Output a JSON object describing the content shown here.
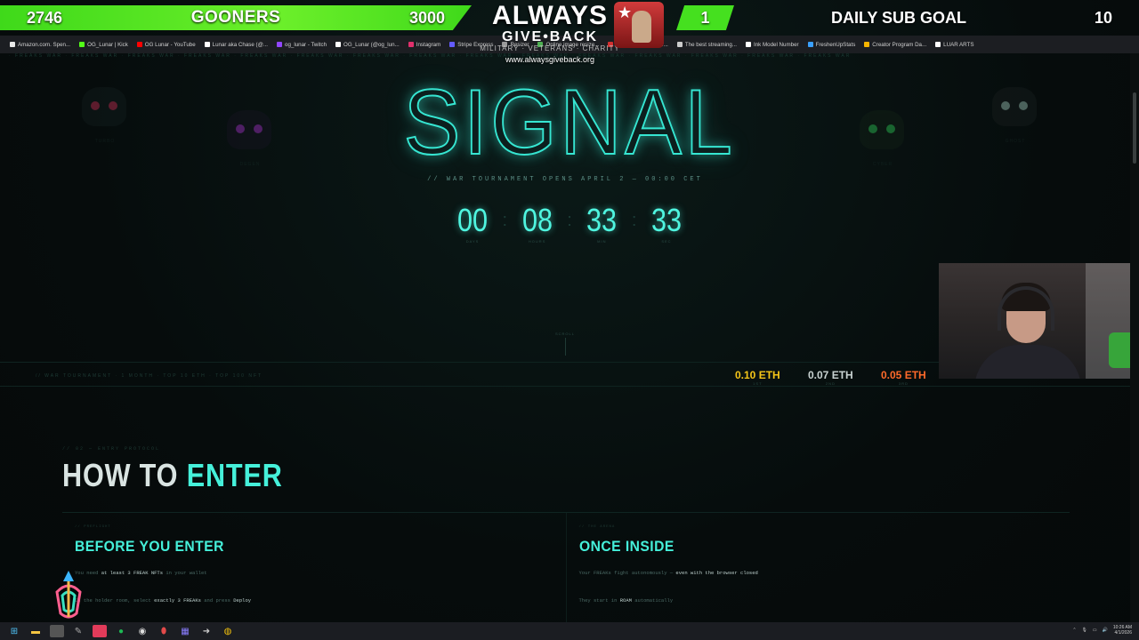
{
  "overlay": {
    "left_goal_current": "2746",
    "left_goal_name": "GOONERS",
    "left_goal_target": "3000",
    "right_goal_current": "1",
    "right_goal_name": "DAILY SUB GOAL",
    "right_goal_target": "10",
    "brand_line1": "ALWAYS",
    "brand_line2": "GIVE•BACK",
    "brand_tagline": "MILITARY · VETERANS · CHARITY",
    "brand_url": "www.alwaysgiveback.org"
  },
  "bookmarks": [
    {
      "label": "Amazon.com. Spen...",
      "color": "#e8e8e8"
    },
    {
      "label": "OG_Lunar | Kick",
      "color": "#53fc18"
    },
    {
      "label": "OG Lunar - YouTube",
      "color": "#ff0000"
    },
    {
      "label": "Lunar aka Chase (@...",
      "color": "#ffffff"
    },
    {
      "label": "og_lunar - Twitch",
      "color": "#9146ff"
    },
    {
      "label": "OG_Lunar (@og_lun...",
      "color": "#ffffff"
    },
    {
      "label": "Instagram",
      "color": "#e1306c"
    },
    {
      "label": "Stripe Express",
      "color": "#635bff"
    },
    {
      "label": "Resizer",
      "color": "#9a9a9a"
    },
    {
      "label": "Online image resize...",
      "color": "#4caf50"
    },
    {
      "label": "Myinstants | The lar...",
      "color": "#d32f2f"
    },
    {
      "label": "The best streaming...",
      "color": "#cccccc"
    },
    {
      "label": "Ink Model Number",
      "color": "#ffffff"
    },
    {
      "label": "FreshenUpStats",
      "color": "#3aa0ff"
    },
    {
      "label": "Creator Program Da...",
      "color": "#f5b400"
    },
    {
      "label": "LUAR ARTS",
      "color": "#ffffff"
    }
  ],
  "hero": {
    "title": "SIGNAL",
    "subtitle": "// WAR TOURNAMENT OPENS APRIL 2 — 00:00 CET",
    "countdown": [
      {
        "value": "00",
        "label": "DAYS"
      },
      {
        "value": "08",
        "label": "HOURS"
      },
      {
        "value": "33",
        "label": "MIN"
      },
      {
        "value": "33",
        "label": "SEC"
      }
    ],
    "scroll_hint": "SCROLL"
  },
  "skulls": [
    {
      "label": "TURBO",
      "eye_color": "#ff3b6b"
    },
    {
      "label": "DEGEN",
      "eye_color": "#d23bff"
    },
    {
      "label": "CYBER",
      "eye_color": "#3bff6b"
    },
    {
      "label": "GHOST",
      "eye_color": "#cfe"
    }
  ],
  "prizes": {
    "left_text": "// WAR TOURNAMENT  ·  1 MONTH  ·  TOP 10 ETH  ·  TOP 100 NFT",
    "items": [
      {
        "amount": "0.10 ETH",
        "place": "1ST",
        "color": "#f5c518"
      },
      {
        "amount": "0.07 ETH",
        "place": "2ND",
        "color": "#c9d3d2"
      },
      {
        "amount": "0.05 ETH",
        "place": "3RD",
        "color": "#ff6a2a"
      }
    ]
  },
  "how": {
    "kicker": "// 02 — ENTRY PROTOCOL",
    "title_white": "HOW TO",
    "title_accent": "ENTER",
    "cards": [
      {
        "kicker": "// PREFLIGHT",
        "title": "BEFORE YOU ENTER",
        "line1_pre": "You need ",
        "line1_bold": "at least 3 FREAK NFTs",
        "line1_post": " in your wallet",
        "line2_pre": "In the holder room, select ",
        "line2_bold": "exactly 3 FREAKs",
        "line2_post": " and press ",
        "line2_bold2": "Deploy"
      },
      {
        "kicker": "// THE ARENA",
        "title": "ONCE INSIDE",
        "line1_pre": "Your FREAKs fight autonomously — ",
        "line1_bold": "even with the browser closed",
        "line1_post": "",
        "line2_pre": "They start in ",
        "line2_bold": "ROAM",
        "line2_post": " automatically",
        "line2_bold2": ""
      }
    ]
  },
  "taskbar": {
    "time": "10:26 AM",
    "date": "4/1/2026"
  },
  "colors": {
    "accent": "#45f0da",
    "overlay_green": "#45e01f"
  }
}
